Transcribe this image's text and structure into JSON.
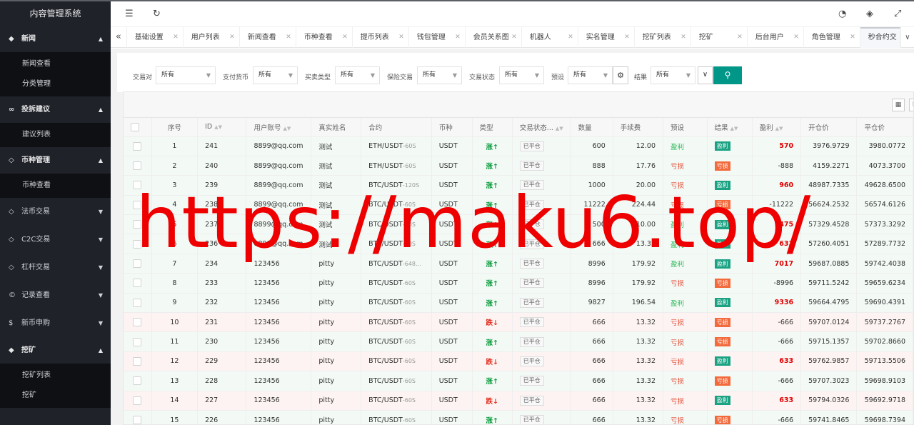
{
  "app": {
    "title": "内容管理系统"
  },
  "sidebar": {
    "groups": [
      {
        "label": "新闻",
        "icon": "tag-icon",
        "expanded": true,
        "items": [
          "新闻查看",
          "分类管理"
        ]
      },
      {
        "label": "投拆建议",
        "icon": "link-icon",
        "expanded": true,
        "items": [
          "建议列表"
        ]
      },
      {
        "label": "币种管理",
        "icon": "diamond-icon",
        "expanded": true,
        "items": [
          "币种查看"
        ]
      },
      {
        "label": "法币交易",
        "icon": "diamond-icon",
        "expanded": false,
        "items": []
      },
      {
        "label": "C2C交易",
        "icon": "diamond-icon",
        "expanded": false,
        "items": []
      },
      {
        "label": "杠杆交易",
        "icon": "diamond-icon",
        "expanded": false,
        "items": []
      },
      {
        "label": "记录查看",
        "icon": "circle-c-icon",
        "expanded": false,
        "items": []
      },
      {
        "label": "新币申购",
        "icon": "dollar-icon",
        "expanded": false,
        "items": []
      },
      {
        "label": "挖矿",
        "icon": "tag-icon",
        "expanded": true,
        "items": [
          "挖矿列表",
          "挖矿"
        ]
      }
    ]
  },
  "tabs": [
    "基础设置",
    "用户列表",
    "新闻查看",
    "币种查看",
    "提币列表",
    "钱包管理",
    "会员关系图",
    "机器人",
    "实名管理",
    "挖矿列表",
    "挖矿",
    "后台用户",
    "角色管理",
    "秒合约交"
  ],
  "filters": [
    {
      "label": "交易对",
      "value": "所有"
    },
    {
      "label": "支付货币",
      "value": "所有"
    },
    {
      "label": "买卖类型",
      "value": "所有"
    },
    {
      "label": "保险交易",
      "value": "所有"
    },
    {
      "label": "交易状态",
      "value": "所有"
    },
    {
      "label": "预设",
      "value": "所有"
    },
    {
      "label": "结果",
      "value": "所有"
    }
  ],
  "table": {
    "headers": [
      "",
      "序号",
      "ID",
      "用户账号",
      "真实姓名",
      "合约",
      "币种",
      "类型",
      "交易状态...",
      "数量",
      "手续费",
      "预设",
      "结果",
      "盈利",
      "开仓价",
      "平仓价"
    ],
    "rows": [
      {
        "no": "1",
        "id": "241",
        "user": "8899@qq.com",
        "name": "测试",
        "pair": "ETH/USDT",
        "sec": "-60S",
        "coin": "USDT",
        "type": "涨↑",
        "status": "已平仓",
        "qty": "600",
        "fee": "12.00",
        "preset": "盈利",
        "result": "盈利",
        "profit": "570",
        "open": "3976.9729",
        "close": "3980.0772"
      },
      {
        "no": "2",
        "id": "240",
        "user": "8899@qq.com",
        "name": "测试",
        "pair": "ETH/USDT",
        "sec": "-60S",
        "coin": "USDT",
        "type": "涨↑",
        "status": "已平仓",
        "qty": "888",
        "fee": "17.76",
        "preset": "亏损",
        "result": "亏损",
        "profit": "-888",
        "open": "4159.2271",
        "close": "4073.3700"
      },
      {
        "no": "3",
        "id": "239",
        "user": "8899@qq.com",
        "name": "测试",
        "pair": "BTC/USDT",
        "sec": "-120S",
        "coin": "USDT",
        "type": "涨↑",
        "status": "已平仓",
        "qty": "1000",
        "fee": "20.00",
        "preset": "亏损",
        "result": "盈利",
        "profit": "960",
        "open": "48987.7335",
        "close": "49628.6500"
      },
      {
        "no": "4",
        "id": "238",
        "user": "8899@qq.com",
        "name": "测试",
        "pair": "BTC/USDT",
        "sec": "-60S",
        "coin": "USDT",
        "type": "涨↑",
        "status": "已平仓",
        "qty": "11222",
        "fee": "224.44",
        "preset": "亏损",
        "result": "亏损",
        "profit": "-11222",
        "open": "56624.2532",
        "close": "56574.6126"
      },
      {
        "no": "5",
        "id": "237",
        "user": "8899@qq.com",
        "name": "测试",
        "pair": "BTC/USDT",
        "sec": "-60S",
        "coin": "USDT",
        "type": "涨↑",
        "status": "已平仓",
        "qty": "500",
        "fee": "10.00",
        "preset": "盈利",
        "result": "盈利",
        "profit": "475",
        "open": "57329.4528",
        "close": "57373.3292"
      },
      {
        "no": "6",
        "id": "236",
        "user": "8899@qq.com",
        "name": "测试",
        "pair": "BTC/USDT",
        "sec": "-60S",
        "coin": "USDT",
        "type": "涨↑",
        "status": "已平仓",
        "qty": "666",
        "fee": "13.32",
        "preset": "盈利",
        "result": "盈利",
        "profit": "633",
        "open": "57260.4051",
        "close": "57289.7732"
      },
      {
        "no": "7",
        "id": "234",
        "user": "123456",
        "name": "pitty",
        "pair": "BTC/USDT",
        "sec": "-648...",
        "coin": "USDT",
        "type": "涨↑",
        "status": "已平仓",
        "qty": "8996",
        "fee": "179.92",
        "preset": "盈利",
        "result": "盈利",
        "profit": "7017",
        "open": "59687.0885",
        "close": "59742.4038"
      },
      {
        "no": "8",
        "id": "233",
        "user": "123456",
        "name": "pitty",
        "pair": "BTC/USDT",
        "sec": "-60S",
        "coin": "USDT",
        "type": "涨↑",
        "status": "已平仓",
        "qty": "8996",
        "fee": "179.92",
        "preset": "亏损",
        "result": "亏损",
        "profit": "-8996",
        "open": "59711.5242",
        "close": "59659.6234"
      },
      {
        "no": "9",
        "id": "232",
        "user": "123456",
        "name": "pitty",
        "pair": "BTC/USDT",
        "sec": "-60S",
        "coin": "USDT",
        "type": "涨↑",
        "status": "已平仓",
        "qty": "9827",
        "fee": "196.54",
        "preset": "盈利",
        "result": "盈利",
        "profit": "9336",
        "open": "59664.4795",
        "close": "59690.4391"
      },
      {
        "no": "10",
        "id": "231",
        "user": "123456",
        "name": "pitty",
        "pair": "BTC/USDT",
        "sec": "-60S",
        "coin": "USDT",
        "type": "跌↓",
        "status": "已平仓",
        "qty": "666",
        "fee": "13.32",
        "preset": "亏损",
        "result": "亏损",
        "profit": "-666",
        "open": "59707.0124",
        "close": "59737.2767"
      },
      {
        "no": "11",
        "id": "230",
        "user": "123456",
        "name": "pitty",
        "pair": "BTC/USDT",
        "sec": "-60S",
        "coin": "USDT",
        "type": "涨↑",
        "status": "已平仓",
        "qty": "666",
        "fee": "13.32",
        "preset": "亏损",
        "result": "亏损",
        "profit": "-666",
        "open": "59715.1357",
        "close": "59702.8660"
      },
      {
        "no": "12",
        "id": "229",
        "user": "123456",
        "name": "pitty",
        "pair": "BTC/USDT",
        "sec": "-60S",
        "coin": "USDT",
        "type": "跌↓",
        "status": "已平仓",
        "qty": "666",
        "fee": "13.32",
        "preset": "亏损",
        "result": "盈利",
        "profit": "633",
        "open": "59762.9857",
        "close": "59713.5506"
      },
      {
        "no": "13",
        "id": "228",
        "user": "123456",
        "name": "pitty",
        "pair": "BTC/USDT",
        "sec": "-60S",
        "coin": "USDT",
        "type": "涨↑",
        "status": "已平仓",
        "qty": "666",
        "fee": "13.32",
        "preset": "亏损",
        "result": "亏损",
        "profit": "-666",
        "open": "59707.3023",
        "close": "59698.9103"
      },
      {
        "no": "14",
        "id": "227",
        "user": "123456",
        "name": "pitty",
        "pair": "BTC/USDT",
        "sec": "-60S",
        "coin": "USDT",
        "type": "跌↓",
        "status": "已平仓",
        "qty": "666",
        "fee": "13.32",
        "preset": "亏损",
        "result": "盈利",
        "profit": "633",
        "open": "59794.0326",
        "close": "59692.9718"
      },
      {
        "no": "15",
        "id": "226",
        "user": "123456",
        "name": "pitty",
        "pair": "BTC/USDT",
        "sec": "-60S",
        "coin": "USDT",
        "type": "涨↑",
        "status": "已平仓",
        "qty": "666",
        "fee": "13.32",
        "preset": "亏损",
        "result": "亏损",
        "profit": "-666",
        "open": "59741.8465",
        "close": "59698.7394"
      }
    ]
  },
  "watermark": "https://maku6.top/",
  "colors": {
    "sidebar": "#20222a",
    "submenu": "#0f1014",
    "search_button": "#009688",
    "up": "#0a9b3c",
    "down": "#e12b1c",
    "watermark": "#ee0000"
  }
}
